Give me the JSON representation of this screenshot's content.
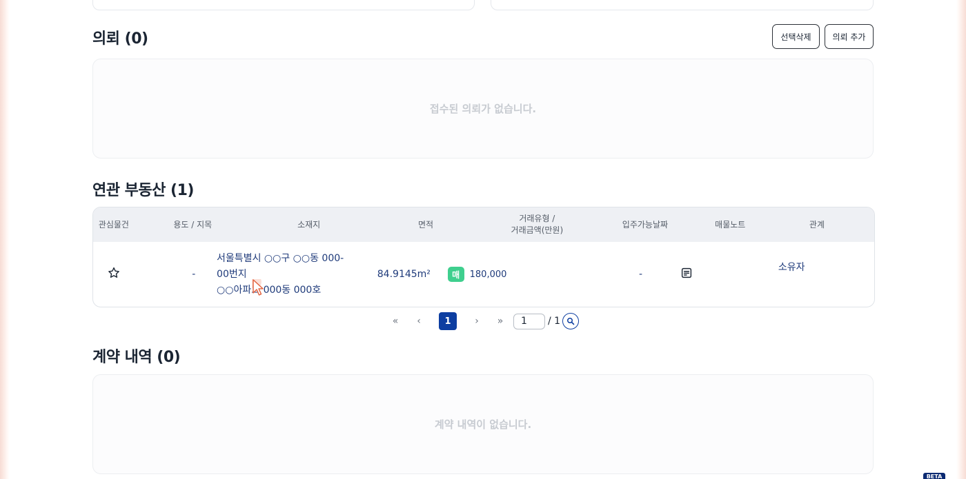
{
  "requests": {
    "title": "의뢰 (0)",
    "delete_selected_label": "선택삭제",
    "add_request_label": "의뢰 추가",
    "empty_message": "접수된 의뢰가 없습니다."
  },
  "related_properties": {
    "title": "연관 부동산 (1)",
    "columns": {
      "favorite": "관심물건",
      "usage": "용도 / 지목",
      "location": "소재지",
      "area": "면적",
      "trade_line1": "거래유형 /",
      "trade_line2": "거래금액(만원)",
      "move_in": "입주가능날짜",
      "note": "매물노트",
      "relation": "관계"
    },
    "rows": [
      {
        "usage": "-",
        "address_line1": "서울특별시 ○○구 ○○동 000-",
        "address_line2": "00번지",
        "address_line3": "○○아파트 000동 000호",
        "area": "84.9145m²",
        "trade_type": "매",
        "price": "180,000",
        "move_in": "-",
        "relation": "소유자"
      }
    ]
  },
  "pagination": {
    "first": "«",
    "prev": "‹",
    "current": "1",
    "next": "›",
    "last": "»",
    "input_value": "1",
    "total": "/ 1"
  },
  "contracts": {
    "title": "계약 내역 (0)",
    "empty_message": "계약 내역이 없습니다."
  },
  "beta_badge": "BETA",
  "colors": {
    "primary": "#0d3ea1",
    "sale_badge": "#3fcf8e",
    "link_text": "#1e3a7a"
  },
  "icons": {
    "favorite": "star-outline-icon",
    "note": "note-icon",
    "search": "search-icon"
  }
}
